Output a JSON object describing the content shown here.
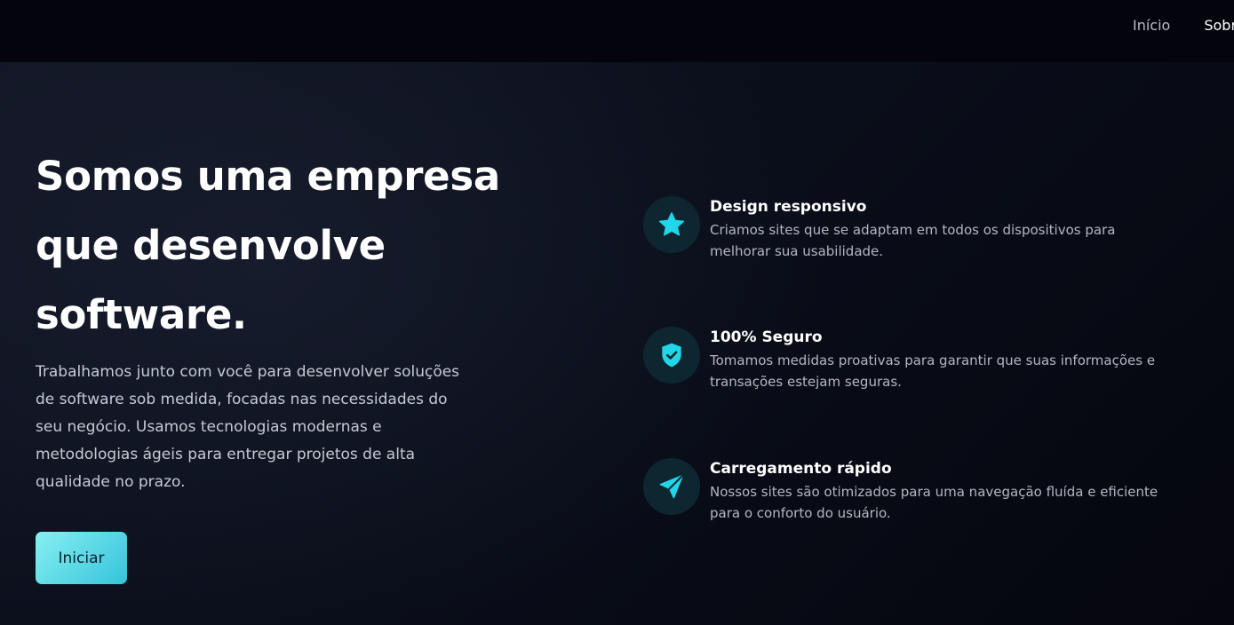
{
  "nav": {
    "items": [
      {
        "label": "Início"
      },
      {
        "label": "Sobre"
      }
    ]
  },
  "hero": {
    "title": "Somos uma empresa que desenvolve software.",
    "description": "Trabalhamos junto com você para desenvolver soluções de software sob medida, focadas nas necessidades do seu negócio. Usamos tecnologias modernas e metodologias ágeis para entregar projetos de alta qualidade no prazo.",
    "cta_label": "Iniciar"
  },
  "features": [
    {
      "icon": "star-icon",
      "title": "Design responsivo",
      "description": "Criamos sites que se adaptam em todos os dispositivos para melhorar sua usabilidade."
    },
    {
      "icon": "shield-check-icon",
      "title": "100% Seguro",
      "description": "Tomamos medidas proativas para garantir que suas informações e transações estejam seguras."
    },
    {
      "icon": "paper-plane-icon",
      "title": "Carregamento rápido",
      "description": "Nossos sites são otimizados para uma navegação fluída e eficiente para o conforto do usuário."
    }
  ],
  "colors": {
    "accent": "#22d6ea",
    "icon_background": "#0d2630",
    "background": "#0b0f1c",
    "button_gradient_start": "#86f0f1",
    "button_gradient_end": "#36c3db"
  }
}
